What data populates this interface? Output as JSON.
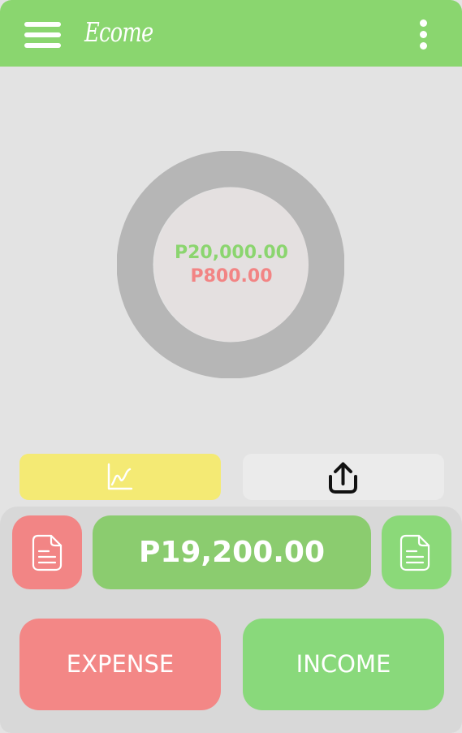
{
  "app": {
    "title": "Ecome"
  },
  "summary": {
    "income_total": "P20,000.00",
    "expense_total": "P800.00",
    "balance": "P19,200.00"
  },
  "toolbar": {
    "menu_icon": "menu-icon",
    "more_icon": "more-vertical-icon",
    "stats_icon": "line-chart-icon",
    "export_icon": "upload-icon"
  },
  "actions": {
    "expense": "EXPENSE",
    "income": "INCOME"
  },
  "icons": {
    "expense_log": "document-icon",
    "income_log": "document-icon"
  },
  "colors": {
    "brand_green": "#8ad66f",
    "income_green": "#8bd56f",
    "expense_red": "#f28484",
    "stats_yellow": "#f4ea74",
    "donut_gray": "#b6b6b6"
  }
}
